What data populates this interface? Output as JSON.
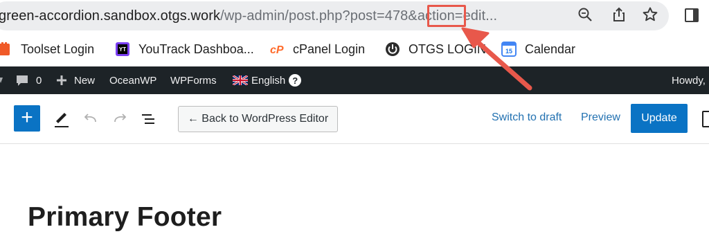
{
  "browser": {
    "url_host": "green-accordion.sandbox.otgs.work",
    "url_path_before": "/wp-admin/post.php?post",
    "url_highlight": "=478",
    "url_path_after": "&action=edit..."
  },
  "bookmarks": [
    {
      "label": "Toolset Login",
      "icon": "toolset-icon"
    },
    {
      "label": "YouTrack Dashboa...",
      "icon": "youtrack-icon"
    },
    {
      "label": "cPanel Login",
      "icon": "cpanel-icon"
    },
    {
      "label": "OTGS LOGIN",
      "icon": "power-icon"
    },
    {
      "label": "Calendar",
      "icon": "calendar-icon",
      "badge": "15"
    }
  ],
  "adminbar": {
    "comments_count": "0",
    "new_label": "New",
    "oceanwp_label": "OceanWP",
    "wpforms_label": "WPForms",
    "language_label": "English",
    "help_glyph": "?",
    "howdy_label": "Howdy,"
  },
  "editor": {
    "add_glyph": "+",
    "back_label": "← Back to WordPress Editor",
    "switch_draft_label": "Switch to draft",
    "preview_label": "Preview",
    "update_label": "Update"
  },
  "content": {
    "title": "Primary Footer"
  },
  "colors": {
    "accent_blue": "#0a73c4",
    "admin_bar": "#1d2327",
    "annotation": "#e8584b"
  }
}
